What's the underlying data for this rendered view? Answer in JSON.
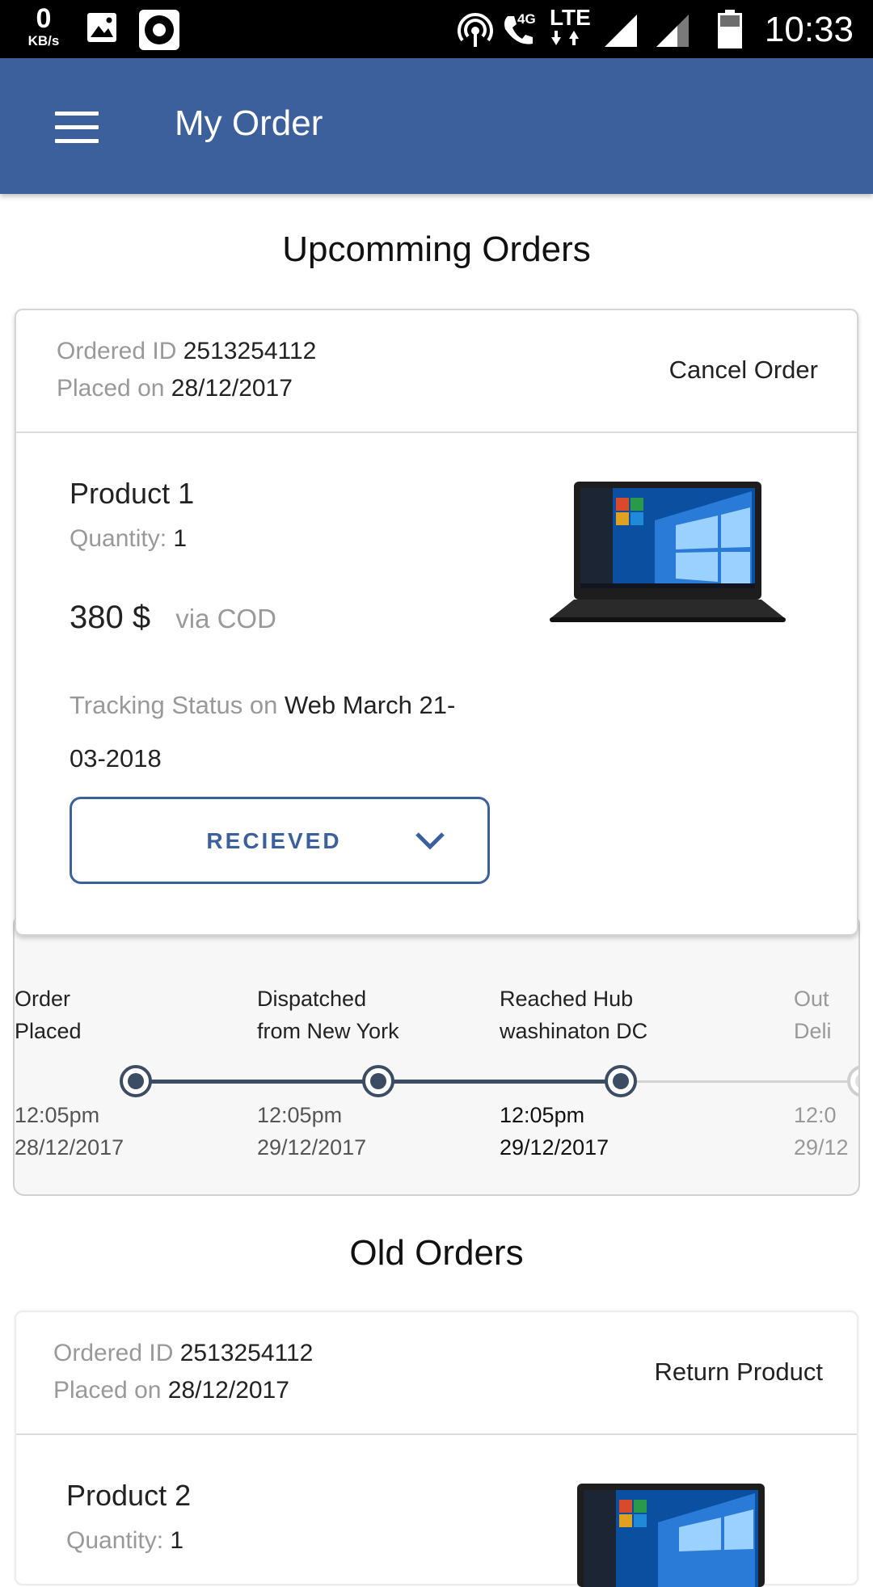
{
  "status_bar": {
    "speed_value": "0",
    "speed_unit": "KB/s",
    "network_4g": "4G",
    "network_lte": "LTE",
    "time": "10:33"
  },
  "app_bar": {
    "title": "My Order",
    "menu_icon": "hamburger-menu-icon"
  },
  "upcoming": {
    "section_title": "Upcomming Orders",
    "order": {
      "id_label": "Ordered ID",
      "id_value": "2513254112",
      "placed_label": "Placed on",
      "placed_value": "28/12/2017",
      "action": "Cancel Order",
      "product_name": "Product 1",
      "quantity_label": "Quantity:",
      "quantity_value": "1",
      "price": "380 $",
      "payment": "via COD",
      "tracking_label": "Tracking Status on",
      "tracking_value": "Web March 21-03-2018",
      "status_button": "RECIEVED",
      "image_icon": "laptop-icon"
    },
    "timeline": [
      {
        "title_line1": "Order",
        "title_line2": "Placed",
        "time": "12:05pm",
        "date": "28/12/2017",
        "done": true
      },
      {
        "title_line1": "Dispatched",
        "title_line2": "from New York",
        "time": "12:05pm",
        "date": "29/12/2017",
        "done": true
      },
      {
        "title_line1": "Reached Hub",
        "title_line2": "washinaton DC",
        "time": "12:05pm",
        "date": "29/12/2017",
        "done": true
      },
      {
        "title_line1": "Out",
        "title_line2": "Deli",
        "time": "12:0",
        "date": "29/12",
        "done": false
      }
    ]
  },
  "old": {
    "section_title": "Old Orders",
    "order": {
      "id_label": "Ordered ID",
      "id_value": "2513254112",
      "placed_label": "Placed on",
      "placed_value": "28/12/2017",
      "action": "Return Product",
      "product_name": "Product 2",
      "quantity_label": "Quantity:",
      "quantity_value": "1",
      "image_icon": "laptop-icon"
    }
  },
  "colors": {
    "primary": "#3c609b",
    "timeline_active": "#3c4c62",
    "muted_text": "#999999"
  }
}
